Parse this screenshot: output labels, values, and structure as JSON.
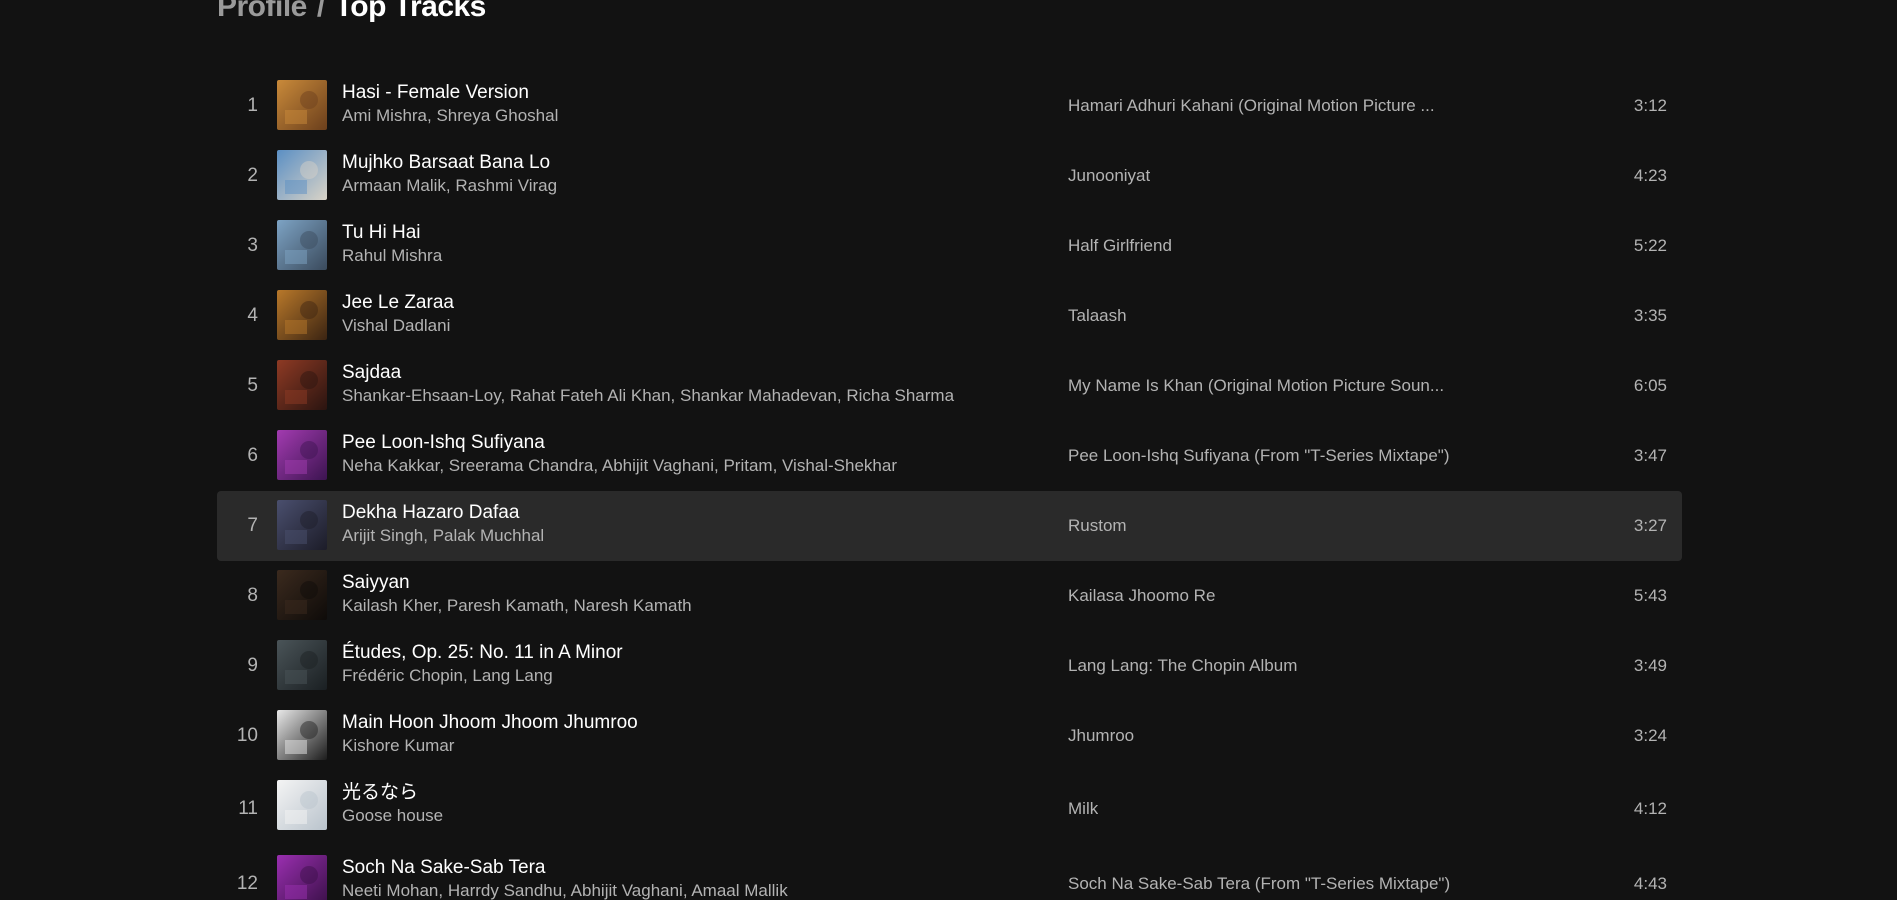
{
  "breadcrumb": {
    "parent": "Profile",
    "separator": "/",
    "current": "Top Tracks"
  },
  "tracks": [
    {
      "index": "1",
      "title": "Hasi - Female Version",
      "artists": "Ami Mishra, Shreya Ghoshal",
      "album": "Hamari Adhuri Kahani (Original Motion Picture ...",
      "duration": "3:12",
      "art_colors": [
        "#c98a3a",
        "#6b3f1c"
      ]
    },
    {
      "index": "2",
      "title": "Mujhko Barsaat Bana Lo",
      "artists": "Armaan Malik, Rashmi Virag",
      "album": "Junooniyat",
      "duration": "4:23",
      "art_colors": [
        "#5b8fc4",
        "#d9d3c7"
      ]
    },
    {
      "index": "3",
      "title": "Tu Hi Hai",
      "artists": "Rahul Mishra",
      "album": "Half Girlfriend",
      "duration": "5:22",
      "art_colors": [
        "#7da3c4",
        "#3a4a5c"
      ]
    },
    {
      "index": "4",
      "title": "Jee Le Zaraa",
      "artists": "Vishal Dadlani",
      "album": "Talaash",
      "duration": "3:35",
      "art_colors": [
        "#b8782a",
        "#3b2412"
      ]
    },
    {
      "index": "5",
      "title": "Sajdaa",
      "artists": "Shankar-Ehsaan-Loy, Rahat Fateh Ali Khan, Shankar Mahadevan, Richa Sharma",
      "album": "My Name Is Khan (Original Motion Picture Soun...",
      "duration": "6:05",
      "art_colors": [
        "#8e3a24",
        "#2a1410"
      ]
    },
    {
      "index": "6",
      "title": "Pee Loon-Ishq Sufiyana",
      "artists": "Neha Kakkar, Sreerama Chandra, Abhijit Vaghani, Pritam, Vishal-Shekhar",
      "album": "Pee Loon-Ishq Sufiyana (From \"T-Series Mixtape\")",
      "duration": "3:47",
      "art_colors": [
        "#a23bb0",
        "#3c1450"
      ]
    },
    {
      "index": "7",
      "title": "Dekha Hazaro Dafaa",
      "artists": "Arijit Singh, Palak Muchhal",
      "album": "Rustom",
      "duration": "3:27",
      "art_colors": [
        "#4a4f6e",
        "#1c1c28"
      ]
    },
    {
      "index": "8",
      "title": "Saiyyan",
      "artists": "Kailash Kher, Paresh Kamath, Naresh Kamath",
      "album": "Kailasa Jhoomo Re",
      "duration": "5:43",
      "art_colors": [
        "#3b2a1e",
        "#0e0b09"
      ]
    },
    {
      "index": "9",
      "title": "Études, Op. 25: No. 11 in A Minor",
      "artists": "Frédéric Chopin, Lang Lang",
      "album": "Lang Lang: The Chopin Album",
      "duration": "3:49",
      "art_colors": [
        "#4a5458",
        "#1a1f22"
      ]
    },
    {
      "index": "10",
      "title": "Main Hoon Jhoom Jhoom Jhumroo",
      "artists": "Kishore Kumar",
      "album": "Jhumroo",
      "duration": "3:24",
      "art_colors": [
        "#e8e8e8",
        "#1c1c1c"
      ]
    },
    {
      "index": "11",
      "title": "光るなら",
      "artists": "Goose house",
      "album": "Milk",
      "duration": "4:12",
      "art_colors": [
        "#f4f4f4",
        "#b9c3cc"
      ]
    },
    {
      "index": "12",
      "title": "Soch Na Sake-Sab Tera",
      "artists": "Neeti Mohan, Harrdy Sandhu, Abhijit Vaghani, Amaal Mallik",
      "album": "Soch Na Sake-Sab Tera (From \"T-Series Mixtape\")",
      "duration": "4:43",
      "art_colors": [
        "#9a2fb0",
        "#3a1048"
      ]
    }
  ],
  "active_track_index": 6
}
